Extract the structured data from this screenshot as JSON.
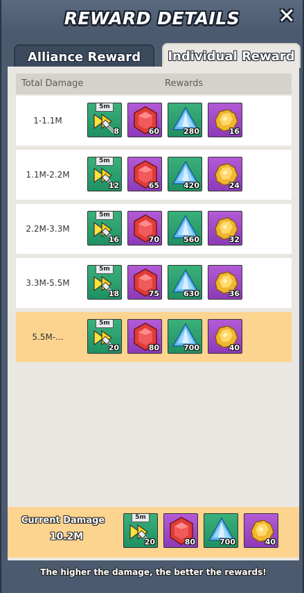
{
  "header": {
    "title": "REWARD DETAILS",
    "close_icon": "close-icon"
  },
  "tabs": [
    {
      "label": "Alliance Reward",
      "active": false
    },
    {
      "label": "Individual Reward",
      "active": true
    }
  ],
  "table": {
    "headers": {
      "damage": "Total Damage",
      "rewards": "Rewards"
    },
    "rows": [
      {
        "range": "1-1.1M",
        "speedup_tag": "5m",
        "speedup": "8",
        "gem": "60",
        "crystal": "280",
        "ore": "16",
        "highlighted": false
      },
      {
        "range": "1.1M-2.2M",
        "speedup_tag": "5m",
        "speedup": "12",
        "gem": "65",
        "crystal": "420",
        "ore": "24",
        "highlighted": false
      },
      {
        "range": "2.2M-3.3M",
        "speedup_tag": "5m",
        "speedup": "16",
        "gem": "70",
        "crystal": "560",
        "ore": "32",
        "highlighted": false
      },
      {
        "range": "3.3M-5.5M",
        "speedup_tag": "5m",
        "speedup": "18",
        "gem": "75",
        "crystal": "630",
        "ore": "36",
        "highlighted": false
      },
      {
        "range": "5.5M-...",
        "speedup_tag": "5m",
        "speedup": "20",
        "gem": "80",
        "crystal": "700",
        "ore": "40",
        "highlighted": true
      }
    ]
  },
  "current": {
    "label": "Current Damage",
    "value": "10.2M",
    "speedup_tag": "5m",
    "speedup": "20",
    "gem": "80",
    "crystal": "700",
    "ore": "40"
  },
  "footer_hint": "The higher the damage, the better the rewards!",
  "colors": {
    "header_bg": "#4b5a6e",
    "panel_bg": "#eae7e2",
    "highlight": "#fcd48f",
    "item_green": "#2aa06e",
    "item_purple": "#a24cc8"
  },
  "icons": [
    "speedup-arrow-icon",
    "red-gem-icon",
    "blue-crystal-icon",
    "gold-ore-icon"
  ]
}
